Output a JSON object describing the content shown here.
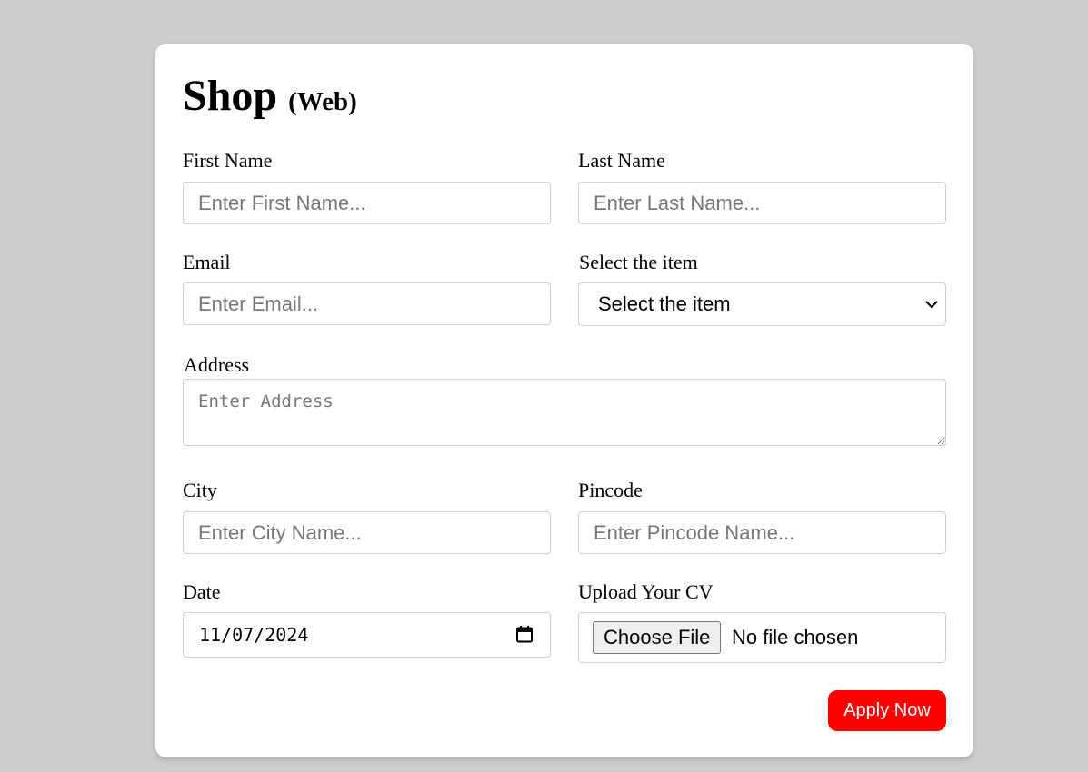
{
  "form": {
    "title": "Shop",
    "title_sub": "(Web)",
    "first_name": {
      "label": "First Name",
      "placeholder": "Enter First Name..."
    },
    "last_name": {
      "label": "Last Name",
      "placeholder": "Enter Last Name..."
    },
    "email": {
      "label": "Email",
      "placeholder": "Enter Email..."
    },
    "item": {
      "label": "Select the item",
      "selected": "Select the item",
      "icon": "chevron-down-icon"
    },
    "address": {
      "label": "Address",
      "placeholder": "Enter Address"
    },
    "city": {
      "label": "City",
      "placeholder": "Enter City Name..."
    },
    "pincode": {
      "label": "Pincode",
      "placeholder": "Enter Pincode Name..."
    },
    "date": {
      "label": "Date",
      "value": "11/07/2024",
      "icon": "calendar-icon"
    },
    "cv": {
      "label": "Upload Your CV",
      "button": "Choose File",
      "status": "No file chosen"
    },
    "submit_label": "Apply Now"
  },
  "colors": {
    "background": "#cccccc",
    "card": "#ffffff",
    "submit_button": "#ff0000",
    "field_border": "#cfcfcf"
  }
}
